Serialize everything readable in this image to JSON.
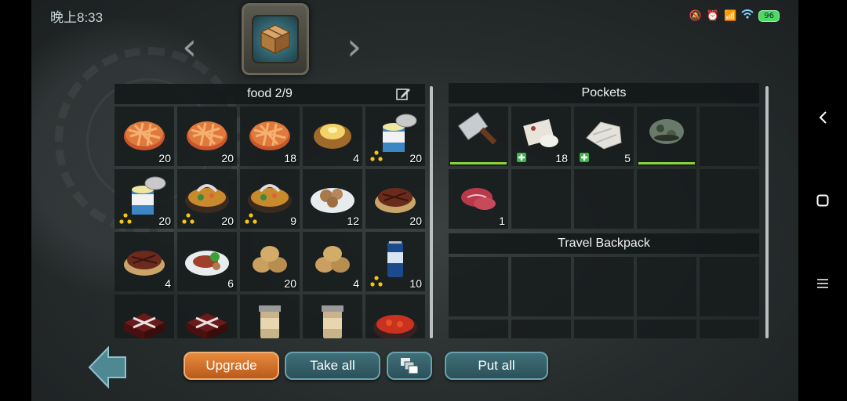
{
  "status": {
    "time": "晚上8:33",
    "battery": "96"
  },
  "container": {
    "left_icon": "‹",
    "right_icon": "›"
  },
  "left_panel": {
    "title": "food 2/9",
    "items": [
      {
        "name": "pie",
        "qty": "20",
        "rad": false
      },
      {
        "name": "pie",
        "qty": "20",
        "rad": false
      },
      {
        "name": "pie",
        "qty": "18",
        "rad": false
      },
      {
        "name": "baked-potato",
        "qty": "4",
        "rad": false
      },
      {
        "name": "canned-milk",
        "qty": "20",
        "rad": true
      },
      {
        "name": "canned-milk",
        "qty": "20",
        "rad": true
      },
      {
        "name": "stew",
        "qty": "20",
        "rad": true
      },
      {
        "name": "stew",
        "qty": "9",
        "rad": true
      },
      {
        "name": "mushroom-plate",
        "qty": "12",
        "rad": false
      },
      {
        "name": "steak",
        "qty": "20",
        "rad": false
      },
      {
        "name": "steak",
        "qty": "4",
        "rad": false
      },
      {
        "name": "steak-plate",
        "qty": "6",
        "rad": false
      },
      {
        "name": "potatoes",
        "qty": "20",
        "rad": false
      },
      {
        "name": "potatoes",
        "qty": "4",
        "rad": false
      },
      {
        "name": "soda-can",
        "qty": "10",
        "rad": true
      },
      {
        "name": "chocolate-box",
        "qty": "",
        "rad": false
      },
      {
        "name": "chocolate-box",
        "qty": "",
        "rad": false
      },
      {
        "name": "jar",
        "qty": "",
        "rad": false
      },
      {
        "name": "jar",
        "qty": "",
        "rad": false
      },
      {
        "name": "crayfish-bowl",
        "qty": "",
        "rad": false
      }
    ]
  },
  "right_panel": {
    "pockets_title": "Pockets",
    "pockets": [
      {
        "name": "cleaver",
        "qty": "",
        "med": false,
        "durability": 1.0
      },
      {
        "name": "bandage",
        "qty": "18",
        "med": true,
        "durability": null
      },
      {
        "name": "cloth-rag",
        "qty": "5",
        "med": true,
        "durability": null
      },
      {
        "name": "camo-mask",
        "qty": "",
        "med": false,
        "durability": 1.0
      },
      {
        "name": "empty",
        "qty": "",
        "med": false,
        "durability": null
      },
      {
        "name": "raw-meat",
        "qty": "1",
        "med": false,
        "durability": null
      }
    ],
    "backpack_title": "Travel Backpack"
  },
  "buttons": {
    "upgrade": "Upgrade",
    "take_all": "Take all",
    "put_all": "Put all"
  },
  "colors": {
    "accent_orange": "#e88a3c",
    "button_teal": "#3f6f79",
    "durability_green": "#8bd23a",
    "radiation_yellow": "#f5c518",
    "medkit_green": "#3fb44b"
  }
}
